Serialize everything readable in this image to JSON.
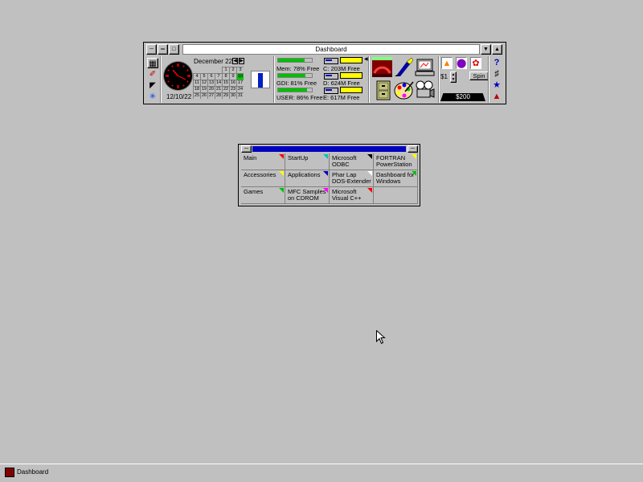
{
  "colors": {
    "desktop": "#c0c0c0",
    "title_active": "#0000c0",
    "bar_green": "#00c000",
    "drive_yellow": "#ffff00"
  },
  "dashboard": {
    "title": "Dashboard",
    "calendar": {
      "month_label": "December 22",
      "days": [
        "",
        "",
        "",
        "",
        "1",
        "2",
        "3",
        "4",
        "5",
        "6",
        "7",
        "8",
        "9",
        "10",
        "11",
        "12",
        "13",
        "14",
        "15",
        "16",
        "17",
        "18",
        "19",
        "20",
        "21",
        "22",
        "23",
        "24",
        "25",
        "26",
        "27",
        "28",
        "29",
        "30",
        "31"
      ],
      "today": "10"
    },
    "clock": {
      "date": "12/10/22"
    },
    "resources": [
      {
        "label": "Mem:  78% Free",
        "percent_free": 78
      },
      {
        "label": "GDI:  81% Free",
        "percent_free": 81
      },
      {
        "label": "USER:  86% Free",
        "percent_free": 86
      }
    ],
    "drives": [
      {
        "label": "C:  203M Free"
      },
      {
        "label": "D:  624M Free"
      },
      {
        "label": "E:  617M Free"
      }
    ],
    "left_tools": [
      "calendar-icon",
      "hammer-icon",
      "eraser-icon",
      "snowflake-icon"
    ],
    "apps": [
      "speedometer-icon",
      "pen-icon",
      "computer-icon",
      "file-cabinet-icon",
      "palette-icon",
      "projector-icon"
    ],
    "slot": {
      "bet": "$1",
      "spin_label": "Spin",
      "total": "$200",
      "symbols": [
        "bell-icon",
        "plum-icon",
        "cherry-icon"
      ]
    },
    "right_tools": [
      "help-icon",
      "wrench-icon",
      "runner-icon",
      "colors-icon"
    ]
  },
  "group": {
    "items": [
      {
        "label": "Main"
      },
      {
        "label": "StartUp"
      },
      {
        "label": "Microsoft\nODBC"
      },
      {
        "label": "FORTRAN\nPowerStation"
      },
      {
        "label": "Accessories"
      },
      {
        "label": "Applications"
      },
      {
        "label": "Phar Lap\nDOS-Extender"
      },
      {
        "label": "Dashboard for\nWindows"
      },
      {
        "label": "Games"
      },
      {
        "label": "MFC Samples\non CDROM"
      },
      {
        "label": "Microsoft\nVisual C++"
      },
      {
        "label": ""
      }
    ]
  },
  "taskbar": {
    "app_label": "Dashboard"
  }
}
